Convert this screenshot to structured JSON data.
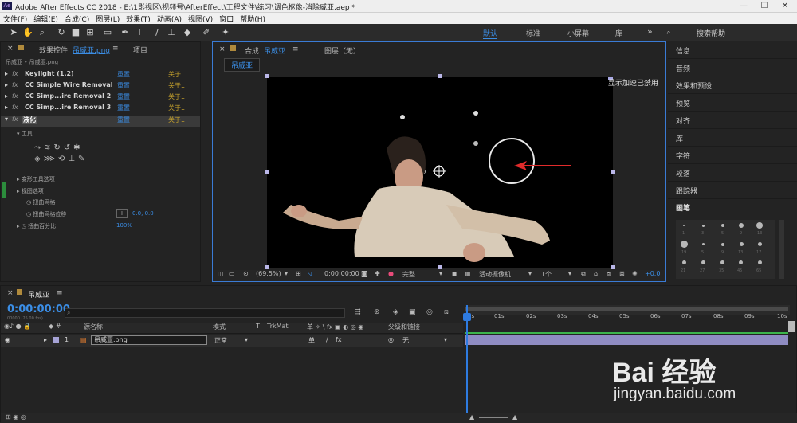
{
  "window": {
    "title": "Adobe After Effects CC 2018 - E:\\1影视区\\视频号\\AfterEffect\\工程文件\\练习\\调色抠像-消除威亚.aep *",
    "app_icon": "Ae",
    "min": "—",
    "max": "☐",
    "close": "✕"
  },
  "menu": [
    "文件(F)",
    "编辑(E)",
    "合成(C)",
    "图层(L)",
    "效果(T)",
    "动画(A)",
    "视图(V)",
    "窗口",
    "帮助(H)"
  ],
  "workspaces": {
    "items": [
      "默认",
      "标准",
      "小屏幕",
      "库"
    ],
    "active": "默认",
    "more": "»",
    "search_placeholder": "搜索帮助"
  },
  "effects_panel": {
    "tab_label": "效果控件",
    "tab_layer": "吊威亚.png",
    "menu": "≡",
    "tab_project": "项目",
    "breadcrumb": "吊威亚 • 吊威亚.png",
    "effects": [
      {
        "name": "Keylight (1.2)",
        "reset": "重置",
        "about": "关于..."
      },
      {
        "name": "CC Simple Wire Removal",
        "reset": "重置",
        "about": "关于..."
      },
      {
        "name": "CC Simp...ire Removal 2",
        "reset": "重置",
        "about": "关于..."
      },
      {
        "name": "CC Simp...ire Removal 3",
        "reset": "重置",
        "about": "关于..."
      },
      {
        "name": "液化",
        "reset": "重置",
        "about": "关于..."
      }
    ],
    "tools_label": "工具",
    "warp_tool_options": "变形工具选项",
    "view_options": "视图选项",
    "distortion_mesh": "扭曲网格",
    "mesh_offset": "扭曲网格位移",
    "mesh_offset_value": "0.0, 0.0",
    "distortion_percent": "扭曲百分比",
    "distortion_percent_value": "100%"
  },
  "comp_panel": {
    "tab_comp": "合成",
    "comp_name": "吊威亚",
    "menu": "≡",
    "tab_layer": "图层（无）",
    "sub_tab": "吊威亚",
    "accel_notice": "显示加速已禁用",
    "zoom": "(69.5%)",
    "timecode": "0:00:00:00",
    "resolution": "完整",
    "camera": "活动摄像机",
    "views": "1个...",
    "exposure": "+0.0"
  },
  "right_panel": {
    "items": [
      "信息",
      "音频",
      "效果和预设",
      "预览",
      "对齐",
      "库",
      "字符",
      "段落",
      "跟踪器"
    ],
    "brush_title": "画笔",
    "brush_sizes": [
      "1",
      "3",
      "5",
      "9",
      "13",
      "19",
      "5",
      "9",
      "13",
      "17",
      "21",
      "27",
      "35",
      "45",
      "65"
    ]
  },
  "timeline": {
    "close": "×",
    "comp_name": "吊威亚",
    "menu": "≡",
    "timecode": "0:00:00:00",
    "timecode_sub": "00000 (25.00 fps)",
    "search_placeholder": "",
    "columns": {
      "source_name": "源名称",
      "mode": "模式",
      "t": "T",
      "trkmat": "TrkMat",
      "switches": "单 ✧ \\ fx ▣ ◐ ◎ ◉",
      "parent": "父级和链接"
    },
    "layers": [
      {
        "index": "1",
        "name": "吊威亚.png",
        "mode": "正常",
        "parent": "无"
      }
    ],
    "ruler": [
      "0s",
      "01s",
      "02s",
      "03s",
      "04s",
      "05s",
      "06s",
      "07s",
      "08s",
      "09s",
      "10s"
    ]
  },
  "watermark": {
    "logo": "Bai 经验",
    "url": "jingyan.baidu.com"
  }
}
